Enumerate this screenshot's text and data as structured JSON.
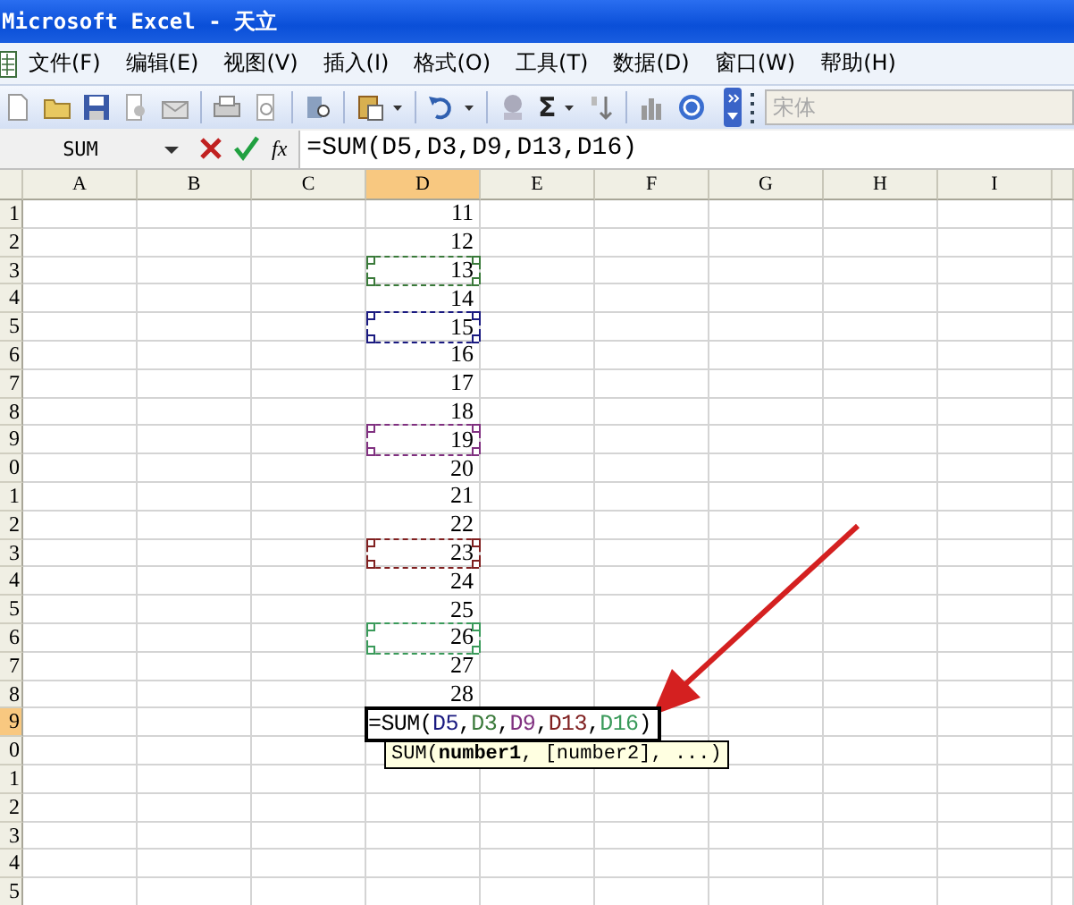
{
  "window": {
    "title": "Microsoft Excel - 天立"
  },
  "menu": [
    {
      "label": "文件(F)"
    },
    {
      "label": "编辑(E)"
    },
    {
      "label": "视图(V)"
    },
    {
      "label": "插入(I)"
    },
    {
      "label": "格式(O)"
    },
    {
      "label": "工具(T)"
    },
    {
      "label": "数据(D)"
    },
    {
      "label": "窗口(W)"
    },
    {
      "label": "帮助(H)"
    }
  ],
  "toolbar": {
    "autosum_symbol": "Σ",
    "font_box": {
      "value": "宋体",
      "disabled": true
    }
  },
  "formula_bar": {
    "name_box": "SUM",
    "function_label": "fx",
    "formula": "=SUM(D5,D3,D9,D13,D16)"
  },
  "columns": [
    {
      "label": "A",
      "selected": false
    },
    {
      "label": "B",
      "selected": false
    },
    {
      "label": "C",
      "selected": false
    },
    {
      "label": "D",
      "selected": true
    },
    {
      "label": "E",
      "selected": false
    },
    {
      "label": "F",
      "selected": false
    },
    {
      "label": "G",
      "selected": false
    },
    {
      "label": "H",
      "selected": false
    },
    {
      "label": "I",
      "selected": false
    }
  ],
  "rows": [
    {
      "header": "1",
      "d": "11",
      "selected": false
    },
    {
      "header": "2",
      "d": "12",
      "selected": false
    },
    {
      "header": "3",
      "d": "13",
      "selected": false,
      "color": "#3a7a3a"
    },
    {
      "header": "4",
      "d": "14",
      "selected": false
    },
    {
      "header": "5",
      "d": "15",
      "selected": false,
      "color": "#1a1a80"
    },
    {
      "header": "6",
      "d": "16",
      "selected": false
    },
    {
      "header": "7",
      "d": "17",
      "selected": false
    },
    {
      "header": "8",
      "d": "18",
      "selected": false
    },
    {
      "header": "9",
      "d": "19",
      "selected": false,
      "color": "#803080"
    },
    {
      "header": "0",
      "d": "20",
      "selected": false
    },
    {
      "header": "1",
      "d": "21",
      "selected": false
    },
    {
      "header": "2",
      "d": "22",
      "selected": false
    },
    {
      "header": "3",
      "d": "23",
      "selected": false,
      "color": "#802020"
    },
    {
      "header": "4",
      "d": "24",
      "selected": false
    },
    {
      "header": "5",
      "d": "25",
      "selected": false
    },
    {
      "header": "6",
      "d": "26",
      "selected": false,
      "color": "#3a9a5a"
    },
    {
      "header": "7",
      "d": "27",
      "selected": false
    },
    {
      "header": "8",
      "d": "28",
      "selected": false
    },
    {
      "header": "9",
      "selected": true,
      "formula_parts": [
        {
          "text": "=SUM("
        },
        {
          "text": "D5",
          "color": "#1a1a80"
        },
        {
          "text": ","
        },
        {
          "text": "D3",
          "color": "#3a7a3a"
        },
        {
          "text": ","
        },
        {
          "text": "D9",
          "color": "#803080"
        },
        {
          "text": ","
        },
        {
          "text": "D13",
          "color": "#802020"
        },
        {
          "text": ","
        },
        {
          "text": "D16",
          "color": "#3a9a5a"
        },
        {
          "text": ")"
        }
      ],
      "tooltip": "SUM(**number1**, [number2], ...)"
    },
    {
      "header": "0",
      "selected": false
    },
    {
      "header": "1",
      "selected": false
    },
    {
      "header": "2",
      "selected": false
    },
    {
      "header": "3",
      "selected": false
    },
    {
      "header": "4",
      "selected": false
    },
    {
      "header": "5",
      "selected": false
    }
  ]
}
